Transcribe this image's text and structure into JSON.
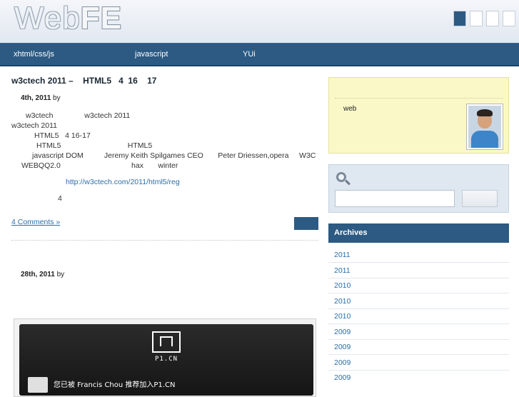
{
  "header": {
    "logo_web": "Web",
    "logo_fe": "FE",
    "swatch_colors": [
      "#2c5a82",
      "#ffffff",
      "#ffffff",
      "#ffffff"
    ]
  },
  "nav": {
    "items": [
      {
        "label": "xhtml/css/js"
      },
      {
        "label": "javascript"
      },
      {
        "label": "YUi"
      }
    ]
  },
  "post1": {
    "title": "w3ctech 2011 –    HTML5   4  16    17",
    "date": "4th, 2011",
    "by": "by",
    "lines": [
      "w3ctech               w3ctech 2011",
      "w3ctech 2011",
      "HTML5   4 16-17",
      "HTML5                                HTML5",
      "javascript DOM          Jeremy Keith Spilgames CEO       Peter Driessen,opera     W3C",
      "WEBQQ2.0                                  hax       winter"
    ],
    "link_text": "http://w3ctech.com/2011/html5/reg",
    "count_line": "4",
    "comments_link": "4 Comments »"
  },
  "post2": {
    "date": "28th, 2011",
    "by": "by"
  },
  "embed": {
    "logo_text": "P1.CN",
    "message": "您已被 Francis Chou 推荐加入P1.CN"
  },
  "sidebar": {
    "profile_text": "web",
    "archives_title": "Archives",
    "archives": [
      "2011",
      "2011",
      "2010",
      "2010",
      "2010",
      "2009",
      "2009",
      "2009",
      "2009"
    ]
  }
}
